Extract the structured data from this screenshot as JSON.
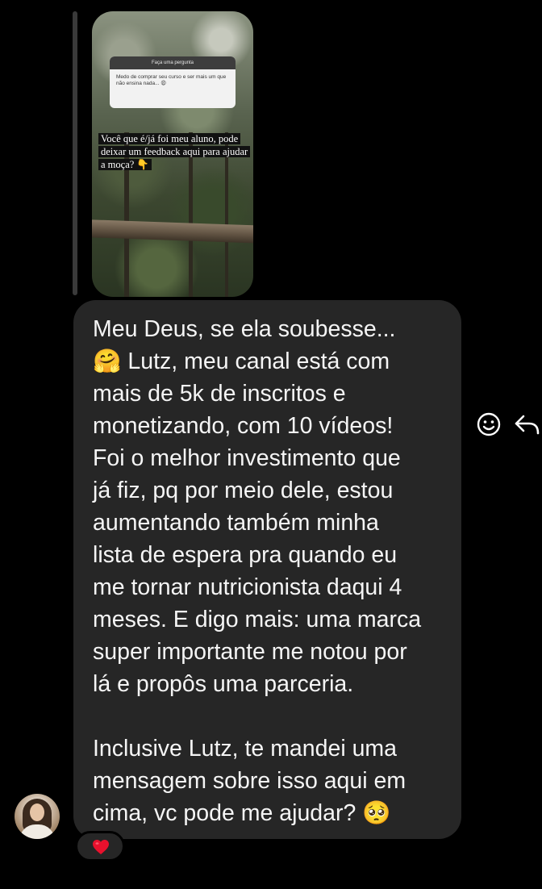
{
  "reply_preview": {
    "question_header": "Faça uma pergunta",
    "question_text": "Medo de comprar seu curso e ser mais um que não ensina nada... 😩",
    "caption": "Você que é/já foi meu aluno, pode deixar um feedback aqui para ajudar a moça? 👇"
  },
  "message": {
    "text": "Meu Deus, se ela soubesse...\n🤗 Lutz, meu canal está com\nmais de 5k de inscritos e\nmonetizando, com 10 vídeos!\nFoi o melhor investimento que\njá fiz, pq por meio dele, estou\naumentando também minha\nlista de espera pra quando eu\nme tornar nutricionista daqui 4\nmeses. E digo mais: uma marca\nsuper importante me notou por\nlá e propôs uma parceria.\n\nInclusive Lutz, te mandei uma\nmensagem sobre isso aqui em\ncima, vc pode me ajudar? 🥺"
  },
  "actions": {
    "react_icon": "smile-icon",
    "reply_icon": "reply-arrow-icon"
  },
  "reaction": {
    "emoji": "❤️",
    "color": "#e8112d"
  },
  "colors": {
    "background": "#000000",
    "bubble": "#262626",
    "text": "#f5f5f5"
  }
}
